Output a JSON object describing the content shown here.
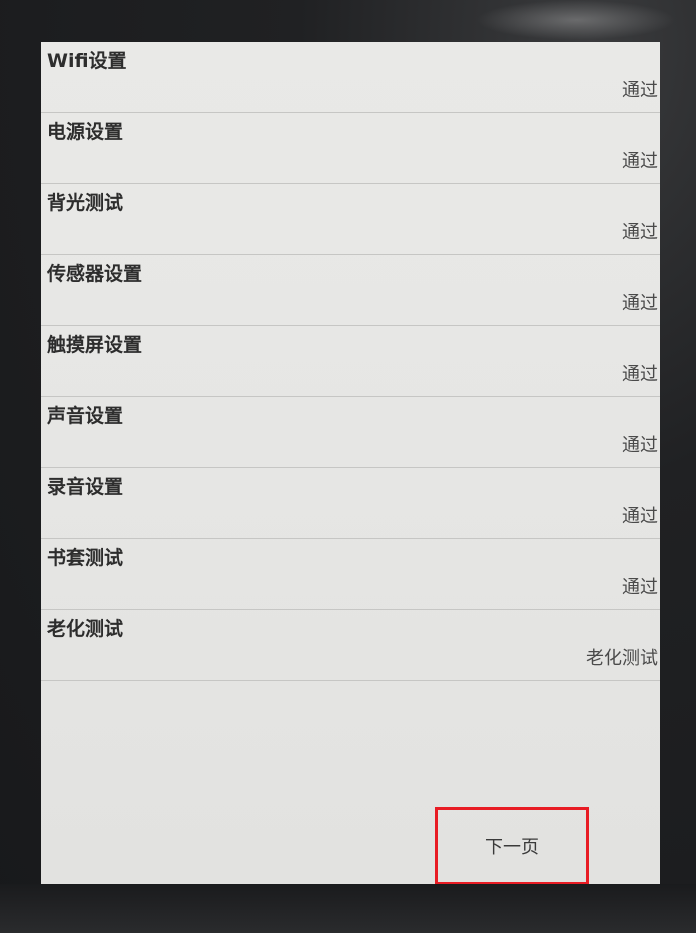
{
  "rows": [
    {
      "label": "Wifi设置",
      "status": "通过"
    },
    {
      "label": "电源设置",
      "status": "通过"
    },
    {
      "label": "背光测试",
      "status": "通过"
    },
    {
      "label": "传感器设置",
      "status": "通过"
    },
    {
      "label": "触摸屏设置",
      "status": "通过"
    },
    {
      "label": "声音设置",
      "status": "通过"
    },
    {
      "label": "录音设置",
      "status": "通过"
    },
    {
      "label": "书套测试",
      "status": "通过"
    },
    {
      "label": "老化测试",
      "status": "老化测试"
    }
  ],
  "footer": {
    "next_label": "下一页"
  },
  "colors": {
    "highlight_border": "#e81c24",
    "screen_bg": "#e8e8e6",
    "bezel": "#1d1e20"
  }
}
